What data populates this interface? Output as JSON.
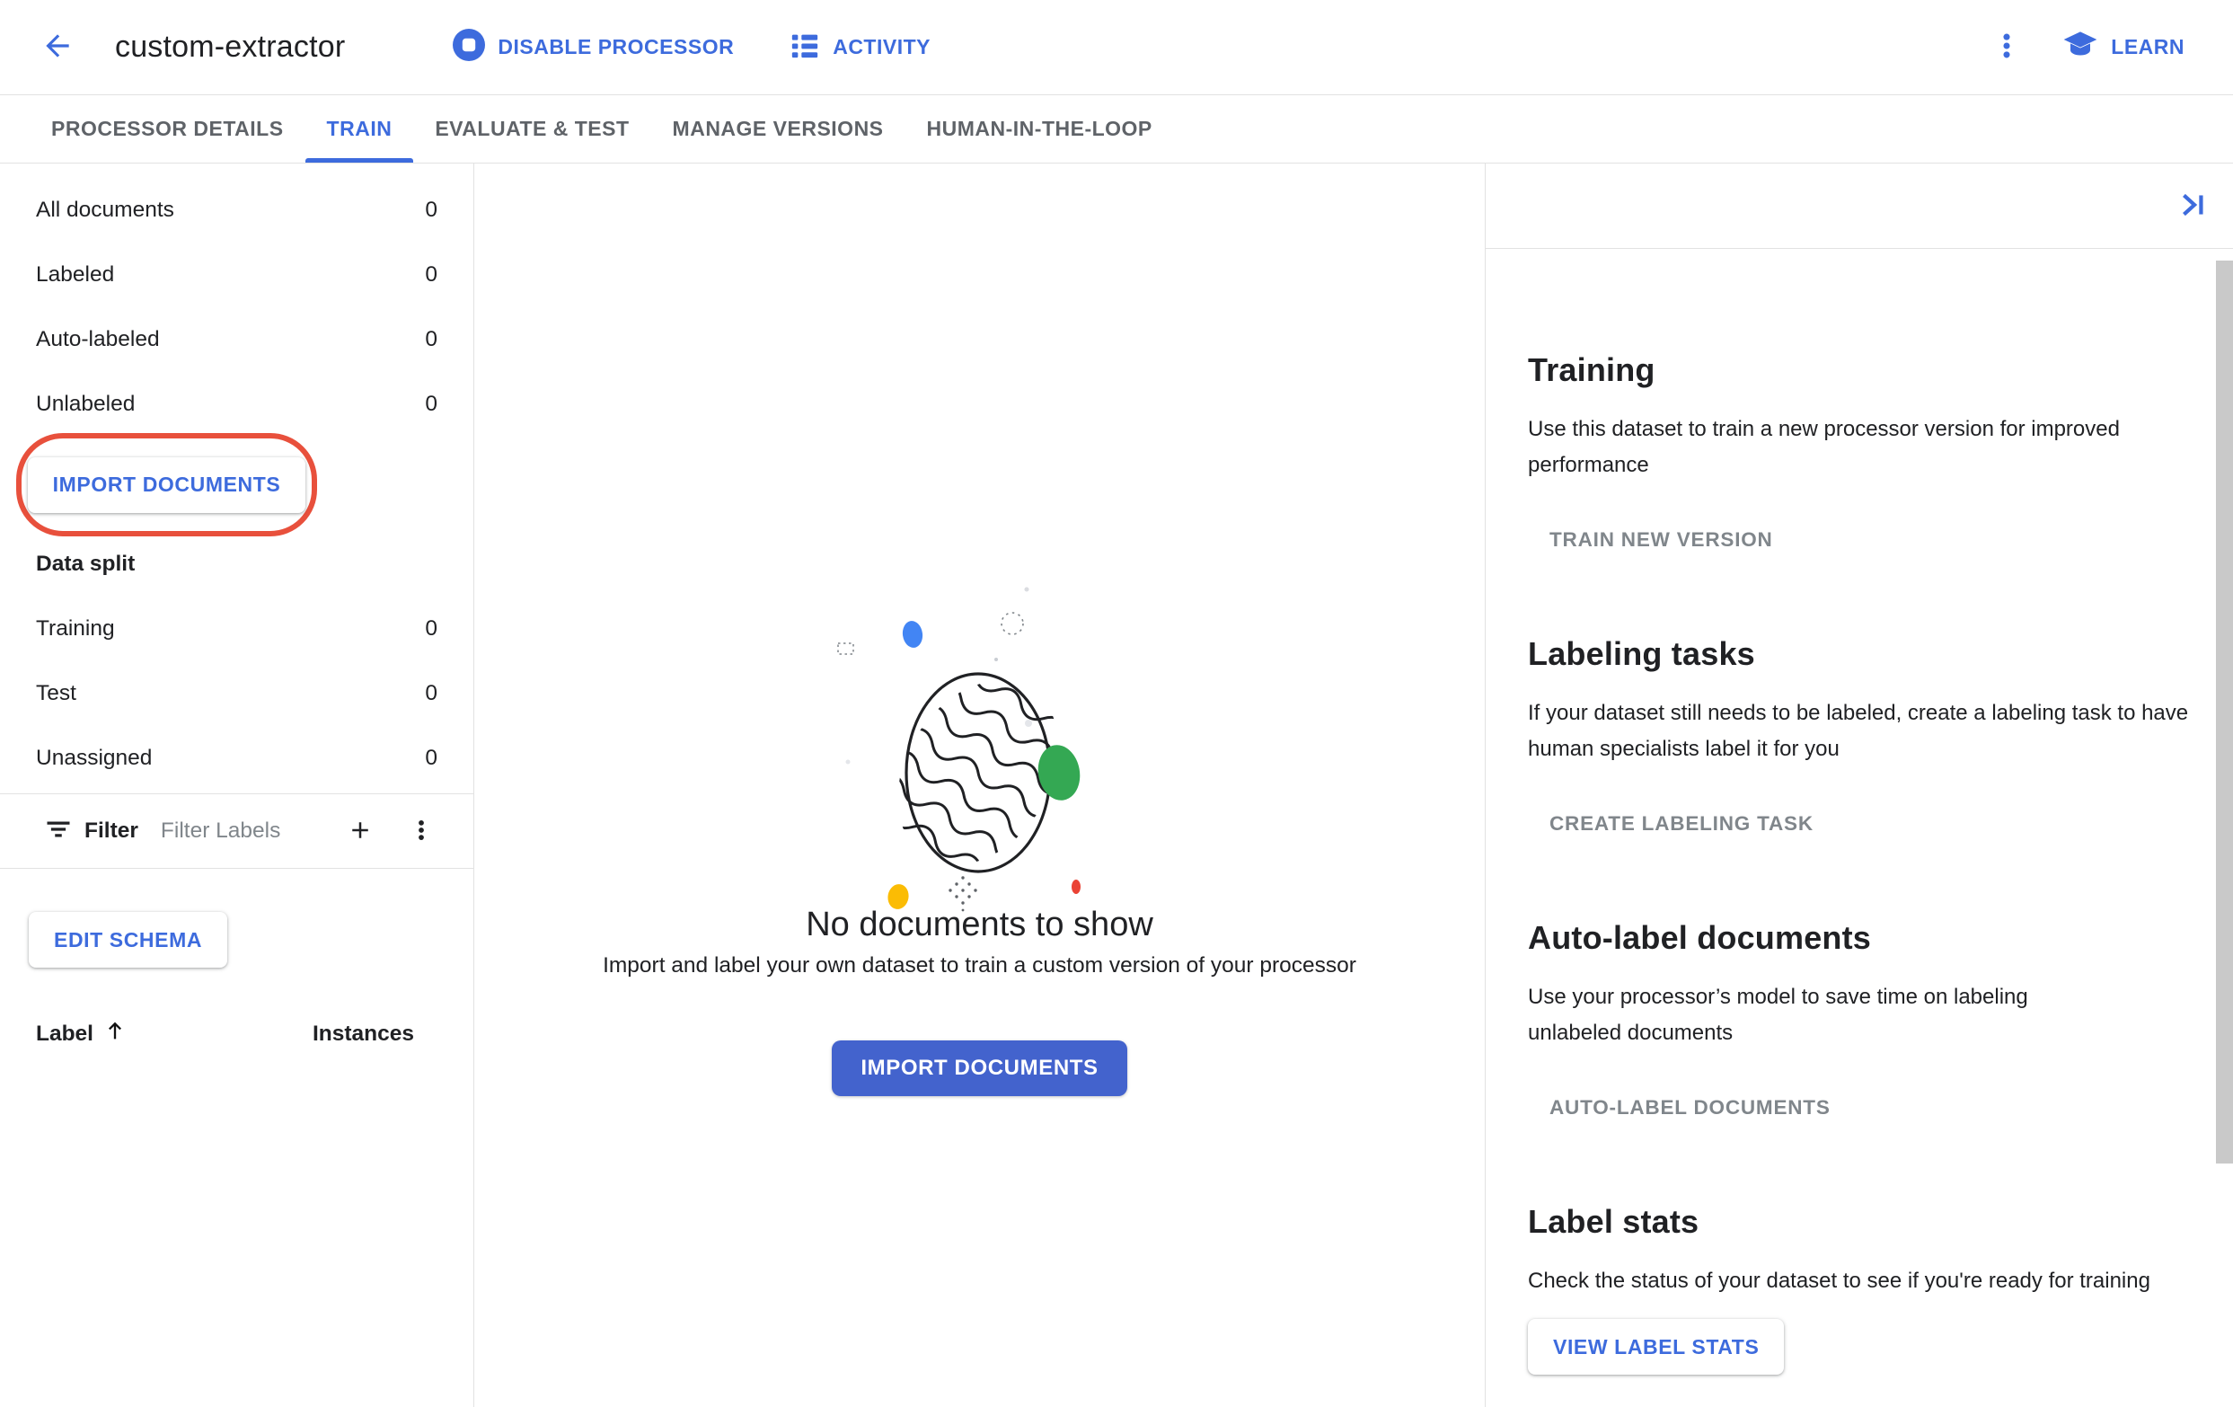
{
  "topbar": {
    "title": "custom-extractor",
    "disable_processor": "DISABLE PROCESSOR",
    "activity": "ACTIVITY",
    "learn": "LEARN"
  },
  "tabs": [
    {
      "label": "PROCESSOR DETAILS",
      "active": false
    },
    {
      "label": "TRAIN",
      "active": true
    },
    {
      "label": "EVALUATE & TEST",
      "active": false
    },
    {
      "label": "MANAGE VERSIONS",
      "active": false
    },
    {
      "label": "HUMAN-IN-THE-LOOP",
      "active": false
    }
  ],
  "sidebar": {
    "doc_stats": [
      {
        "label": "All documents",
        "count": "0"
      },
      {
        "label": "Labeled",
        "count": "0"
      },
      {
        "label": "Auto-labeled",
        "count": "0"
      },
      {
        "label": "Unlabeled",
        "count": "0"
      }
    ],
    "import_documents": "IMPORT DOCUMENTS",
    "data_split_header": "Data split",
    "split_stats": [
      {
        "label": "Training",
        "count": "0"
      },
      {
        "label": "Test",
        "count": "0"
      },
      {
        "label": "Unassigned",
        "count": "0"
      }
    ],
    "filter_label": "Filter",
    "filter_placeholder": "Filter Labels",
    "edit_schema": "EDIT SCHEMA",
    "label_header": "Label",
    "instances_header": "Instances"
  },
  "main": {
    "empty_title": "No documents to show",
    "empty_subtitle": "Import and label your own dataset to train a custom version of your processor",
    "import_button": "IMPORT DOCUMENTS"
  },
  "right_panel": {
    "sections": [
      {
        "title": "Training",
        "body": "Use this dataset to train a new processor version for improved performance",
        "button": "TRAIN NEW VERSION",
        "button_state": "disabled"
      },
      {
        "title": "Labeling tasks",
        "body": "If your dataset still needs to be labeled, create a labeling task to have human specialists label it for you",
        "button": "CREATE LABELING TASK",
        "button_state": "disabled"
      },
      {
        "title": "Auto-label documents",
        "body": "Use your processor’s model to save time on labeling unlabeled documents",
        "button": "AUTO-LABEL DOCUMENTS",
        "button_state": "disabled"
      },
      {
        "title": "Label stats",
        "body": "Check the status of your dataset to see if you're ready for training",
        "button": "VIEW LABEL STATS",
        "button_state": "enabled"
      }
    ]
  },
  "icons": {
    "back": "arrow-left",
    "disable_processor": "stop-circle",
    "activity": "list",
    "overflow_menu": "kebab-vertical",
    "learn": "graduation-cap",
    "collapse_panel": "chevron-right-to-bar",
    "filter": "filter-lines",
    "add_label": "plus",
    "filter_menu": "kebab-vertical",
    "sort": "arrow-up"
  },
  "colors": {
    "accent_blue": "#3d6bdd",
    "primary_button_blue": "#4363cd",
    "annotation_red": "#e8503c",
    "inactive_tab_gray": "#5f6368",
    "disabled_text_gray": "#80868b",
    "divider_gray": "#e2e2e2",
    "scrollbar_gray": "#c9c9c9",
    "illustration_blue": "#4285f4",
    "illustration_green": "#34a853",
    "illustration_yellow": "#fbbc04",
    "illustration_red": "#ea4335"
  }
}
